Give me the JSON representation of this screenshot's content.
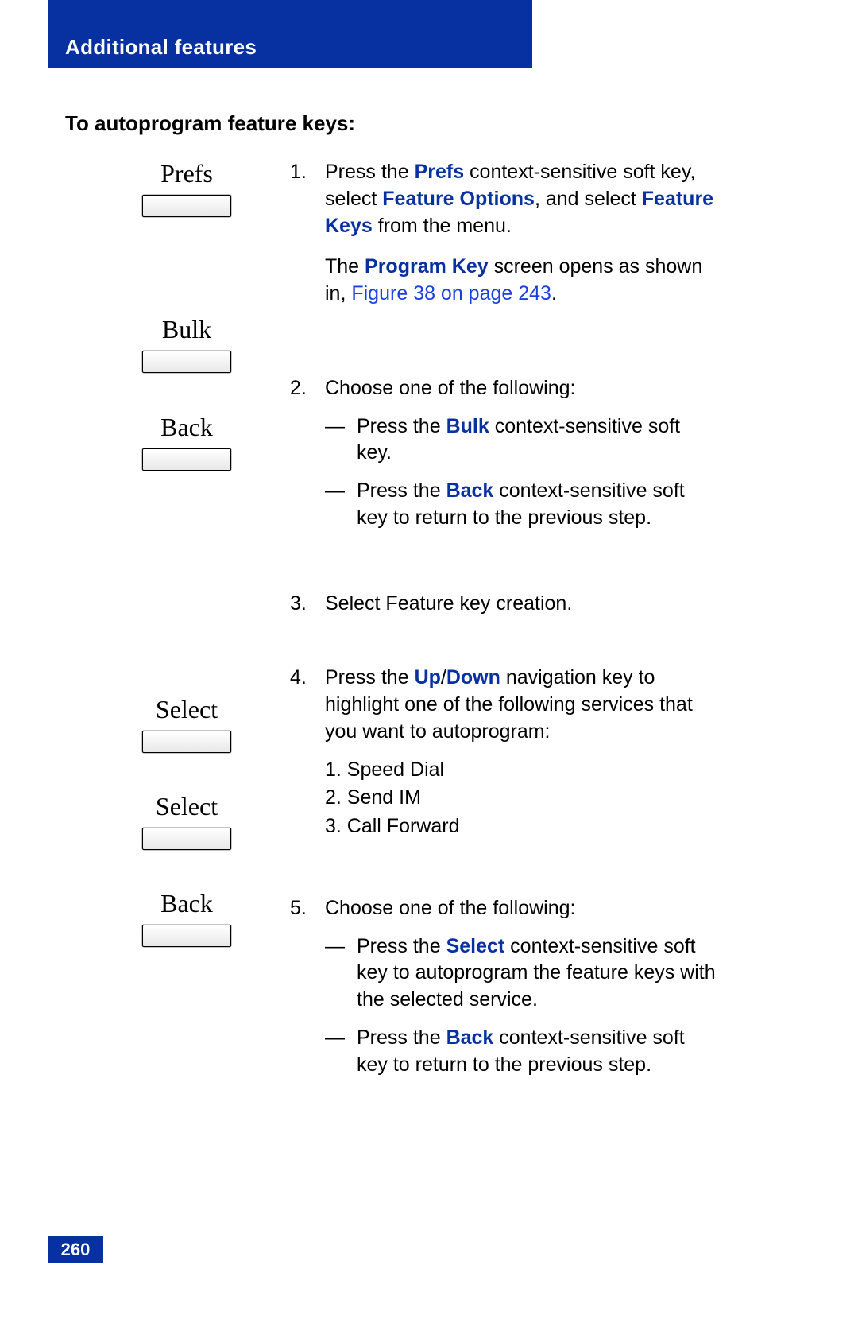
{
  "header": {
    "title": "Additional features"
  },
  "section_heading": "To autoprogram feature keys:",
  "soft_keys": {
    "prefs": "Prefs",
    "bulk": "Bulk",
    "back1": "Back",
    "select1": "Select",
    "select2": "Select",
    "back2": "Back"
  },
  "steps": {
    "s1": {
      "num": "1.",
      "t1a": "Press the ",
      "kw_prefs": "Prefs",
      "t1b": " context-sensitive soft key, select ",
      "kw_feature_options": "Feature Options",
      "t1c": ", and select ",
      "kw_feature_keys": "Feature Keys",
      "t1d": " from the menu.",
      "t2a": "The ",
      "kw_program_key": "Program Key",
      "t2b": " screen opens as shown in, ",
      "link_fig": "Figure 38 on page 243",
      "t2c": "."
    },
    "s2": {
      "num": "2.",
      "lead": "Choose one of the following:",
      "sub1a": "Press the ",
      "sub1_kw": "Bulk",
      "sub1b": " context-sensitive soft key.",
      "sub2a": "Press the ",
      "sub2_kw": "Back",
      "sub2b": " context-sensitive soft key to return to the previous step."
    },
    "s3": {
      "num": "3.",
      "text": "Select Feature key creation."
    },
    "s4": {
      "num": "4.",
      "t1a": "Press the ",
      "kw_up": "Up",
      "slash": "/",
      "kw_down": "Down",
      "t1b": " navigation key to highlight one of the following services that you want to autoprogram:",
      "svc1": "1. Speed Dial",
      "svc2": "2. Send IM",
      "svc3": "3. Call Forward"
    },
    "s5": {
      "num": "5.",
      "lead": "Choose one of the following:",
      "sub1a": "Press the ",
      "sub1_kw": "Select",
      "sub1b": " context-sensitive soft key to autoprogram the feature keys with the selected service.",
      "sub2a": "Press the ",
      "sub2_kw": "Back",
      "sub2b": " context-sensitive soft key to return to the previous step."
    }
  },
  "dash": "—",
  "page_number": "260"
}
